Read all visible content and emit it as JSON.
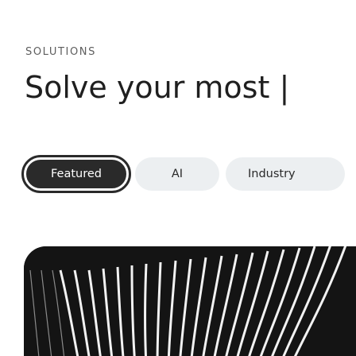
{
  "section": {
    "eyebrow": "SOLUTIONS",
    "headline": "Solve your most |"
  },
  "tabs": [
    {
      "label": "Featured",
      "selected": true
    },
    {
      "label": "AI",
      "selected": false
    },
    {
      "label": "Industry",
      "selected": false
    }
  ],
  "colors": {
    "selected_tab_bg": "#2a2a2a",
    "unselected_tab_bg": "#eceff1",
    "card_bg": "#141414",
    "text_dark": "#1f1f1f",
    "text_muted": "#5e5e5e"
  }
}
